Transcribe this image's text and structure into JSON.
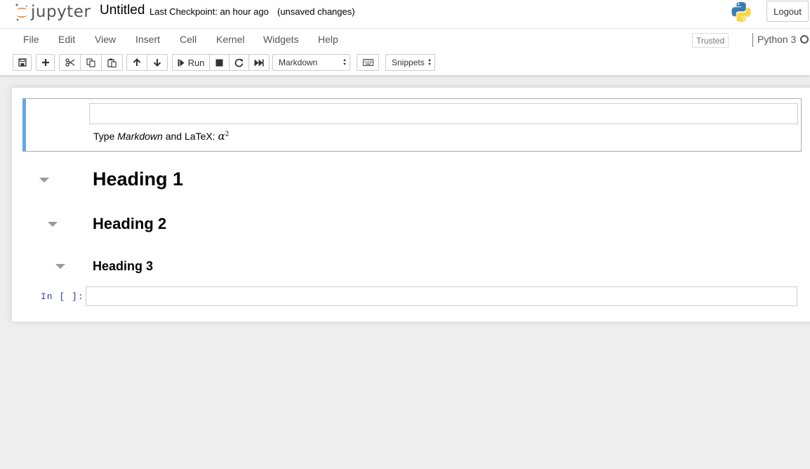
{
  "header": {
    "logo_text": "jupyter",
    "notebook_name": "Untitled",
    "checkpoint": "Last Checkpoint: an hour ago",
    "autosave": "(unsaved changes)",
    "logout_label": "Logout",
    "logo_icon": "jupyter-logo-icon",
    "python_icon": "python-logo-icon"
  },
  "menubar": {
    "items": [
      "File",
      "Edit",
      "View",
      "Insert",
      "Cell",
      "Kernel",
      "Widgets",
      "Help"
    ],
    "trusted_label": "Trusted",
    "kernel_name": "Python 3"
  },
  "toolbar": {
    "run_label": "Run",
    "cell_type": "Markdown",
    "snippets_label": "Snippets",
    "icons": [
      "save-icon",
      "plus-icon",
      "cut-icon",
      "copy-icon",
      "paste-icon",
      "arrow-up-icon",
      "arrow-down-icon",
      "step-forward-icon",
      "stop-icon",
      "restart-icon",
      "fast-forward-icon",
      "keyboard-icon"
    ]
  },
  "notebook": {
    "markdown_cell": {
      "text_prefix": "Type ",
      "text_emphasis": "Markdown",
      "text_suffix": " and LaTeX: ",
      "math_base": "α",
      "math_exp": "2"
    },
    "headings": [
      "Heading 1",
      "Heading 2",
      "Heading 3"
    ],
    "code_cell": {
      "prompt": "In [ ]:"
    }
  },
  "colors": {
    "selected_cell_border": "#66a9e0",
    "prompt_color": "#303f9f",
    "logo_orange": "#f37726",
    "background": "#eeeeee"
  }
}
